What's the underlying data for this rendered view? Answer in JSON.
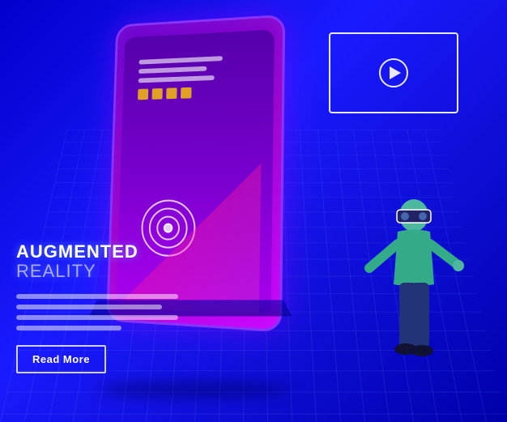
{
  "page": {
    "title": "Augmented Reality",
    "bg_color": "#1a1aff",
    "accent_color": "#9900cc"
  },
  "hero": {
    "title_line1": "AUGMENTED",
    "title_line2": "REALITY",
    "description_lines": 4,
    "read_more_label": "Read More",
    "video_alt": "Video player card",
    "person_alt": "Person wearing VR headset"
  },
  "ui": {
    "play_icon": "▶"
  }
}
